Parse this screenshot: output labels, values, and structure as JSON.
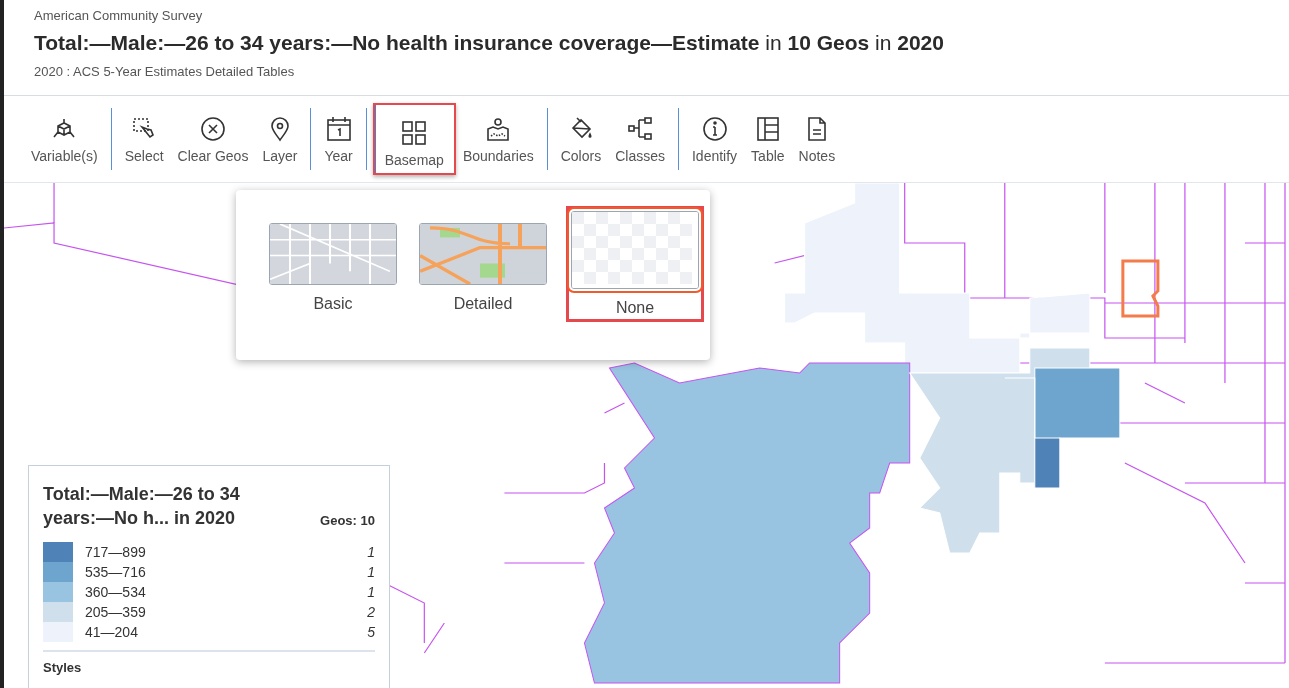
{
  "header": {
    "source": "American Community Survey",
    "title": "**Total:—Male:—26 to 34 years:—No health insurance coverage—Estimate** in **10 Geos** in **2020**",
    "subtitle": "2020 : ACS 5-Year Estimates Detailed Tables"
  },
  "toolbar": [
    [
      {
        "label": "Variable(s)",
        "selected": false
      }
    ],
    [
      {
        "label": "Select",
        "selected": false
      },
      {
        "label": "Clear Geos",
        "selected": false
      },
      {
        "label": "Layer",
        "selected": false
      }
    ],
    [
      {
        "label": "Year",
        "selected": false
      }
    ],
    [
      {
        "label": "Basemap",
        "selected": true
      },
      {
        "label": "Boundaries",
        "selected": false
      }
    ],
    [
      {
        "label": "Colors",
        "selected": false
      },
      {
        "label": "Classes",
        "selected": false
      }
    ],
    [
      {
        "label": "Identify",
        "selected": false
      },
      {
        "label": "Table",
        "selected": false
      },
      {
        "label": "Notes",
        "selected": false
      }
    ]
  ],
  "basemap_options": [
    {
      "label": "Basic",
      "kind": "basic",
      "selected": false
    },
    {
      "label": "Detailed",
      "kind": "detailed",
      "selected": false
    },
    {
      "label": "None",
      "kind": "none",
      "selected": true
    }
  ],
  "legend": {
    "title": "Total:—Male:—26 to 34 years:—No h... in 2020",
    "geos": "Geos: 10",
    "classes": [
      {
        "range": "717—899",
        "count": "1",
        "color": "#4f83b8"
      },
      {
        "range": "535—716",
        "count": "1",
        "color": "#6ea5cf"
      },
      {
        "range": "360—534",
        "count": "1",
        "color": "#98c4e1"
      },
      {
        "range": "205—359",
        "count": "2",
        "color": "#cfe0ec"
      },
      {
        "range": "41—204",
        "count": "5",
        "color": "#eef3fb"
      }
    ],
    "styles_label": "Styles"
  }
}
